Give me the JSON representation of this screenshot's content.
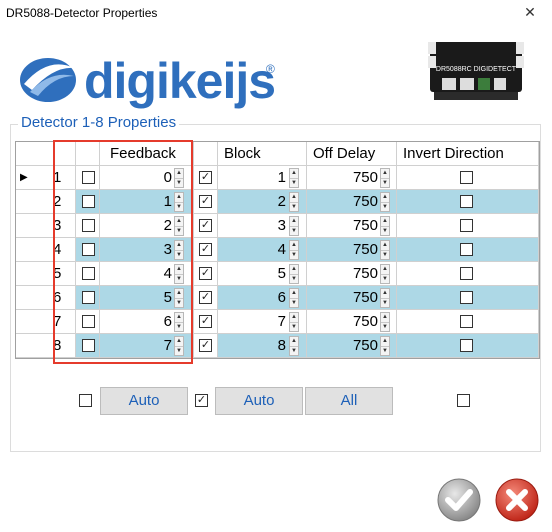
{
  "window": {
    "title": "DR5088-Detector Properties"
  },
  "logo": {
    "text": "digikeijs",
    "reg": "®"
  },
  "device": {
    "label": "DR5088RC DIGIDETECT"
  },
  "group": {
    "title": "Detector 1-8 Properties"
  },
  "grid": {
    "columns": [
      "Feedback",
      "Block",
      "Off Delay",
      "Invert Direction"
    ],
    "rows": [
      {
        "num": "1",
        "fb_check": false,
        "feedback": "0",
        "block_check": true,
        "block": "1",
        "off_delay": "750",
        "invert": false
      },
      {
        "num": "2",
        "fb_check": false,
        "feedback": "1",
        "block_check": true,
        "block": "2",
        "off_delay": "750",
        "invert": false
      },
      {
        "num": "3",
        "fb_check": false,
        "feedback": "2",
        "block_check": true,
        "block": "3",
        "off_delay": "750",
        "invert": false
      },
      {
        "num": "4",
        "fb_check": false,
        "feedback": "3",
        "block_check": true,
        "block": "4",
        "off_delay": "750",
        "invert": false
      },
      {
        "num": "5",
        "fb_check": false,
        "feedback": "4",
        "block_check": true,
        "block": "5",
        "off_delay": "750",
        "invert": false
      },
      {
        "num": "6",
        "fb_check": false,
        "feedback": "5",
        "block_check": true,
        "block": "6",
        "off_delay": "750",
        "invert": false
      },
      {
        "num": "7",
        "fb_check": false,
        "feedback": "6",
        "block_check": true,
        "block": "7",
        "off_delay": "750",
        "invert": false
      },
      {
        "num": "8",
        "fb_check": false,
        "feedback": "7",
        "block_check": true,
        "block": "8",
        "off_delay": "750",
        "invert": false
      }
    ],
    "current_row_marker": "▶"
  },
  "footer": {
    "feedback_auto_label": "Auto",
    "block_auto_label": "Auto",
    "delay_all_label": "All",
    "feedback_all_checked": false,
    "block_all_checked": true,
    "invert_all_checked": false
  },
  "dialog": {
    "ok_icon": "check-icon",
    "cancel_icon": "x-icon"
  },
  "colors": {
    "accent": "#1d60b8",
    "row_alt": "#add8e6",
    "highlight": "#e53b2c"
  }
}
